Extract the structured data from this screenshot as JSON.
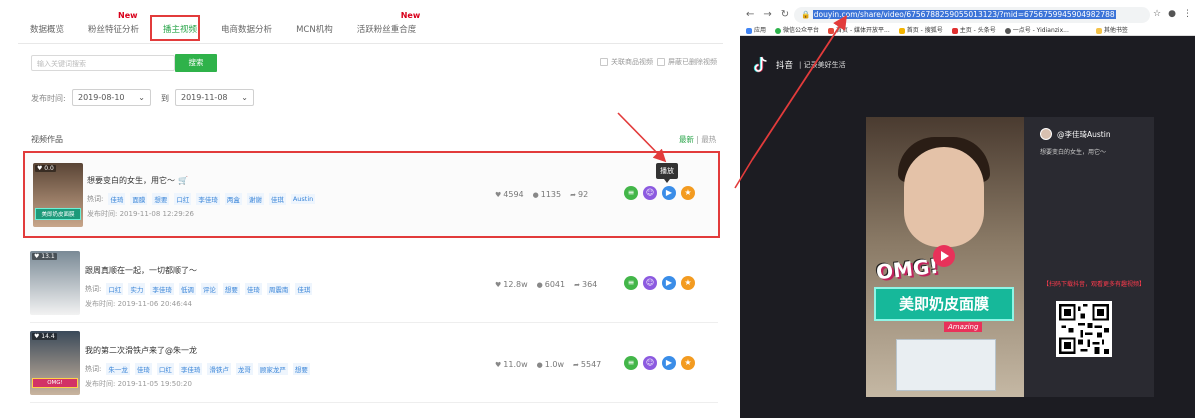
{
  "tabs": [
    {
      "label": "数据概览",
      "is_new": false,
      "active": false
    },
    {
      "label": "粉丝特征分析",
      "is_new": true,
      "active": false
    },
    {
      "label": "播主视频",
      "is_new": false,
      "active": true
    },
    {
      "label": "电商数据分析",
      "is_new": false,
      "active": false
    },
    {
      "label": "MCN机构",
      "is_new": false,
      "active": false
    },
    {
      "label": "活跃粉丝重合度",
      "is_new": true,
      "active": false
    }
  ],
  "new_badge": "New",
  "search": {
    "placeholder": "输入关键词搜索",
    "button": "搜索"
  },
  "filters": {
    "related_goods": "关联商品视频",
    "hide_deleted": "屏蔽已删除视频"
  },
  "date": {
    "label": "发布时间:",
    "start": "2019-08-10",
    "to": "到",
    "end": "2019-11-08"
  },
  "section": {
    "title": "视频作品",
    "sort_new": "最新",
    "sort_sep": "|",
    "sort_hot": "最热"
  },
  "hot_label": "热词:",
  "pub_label": "发布时间:",
  "videos": [
    {
      "likes": "0.0",
      "thumb_caption": "美即奶皮面膜",
      "title": "想要变白的女生，用它～",
      "has_cart": true,
      "tags": [
        "佳琦",
        "面膜",
        "想要",
        "口红",
        "李佳琦",
        "两盒",
        "谢谢",
        "佳琪",
        "Austin"
      ],
      "time": "2019-11-08 12:29:26",
      "stat_like": "4594",
      "stat_comment": "1135",
      "stat_share": "92"
    },
    {
      "likes": "13.1",
      "thumb_caption": "",
      "title": "跟周真顺在一起，一切都顺了～",
      "has_cart": false,
      "tags": [
        "口红",
        "实力",
        "李佳琦",
        "低调",
        "评论",
        "想要",
        "佳琦",
        "周震南",
        "佳琪"
      ],
      "time": "2019-11-06 20:46:44",
      "stat_like": "12.8w",
      "stat_comment": "6041",
      "stat_share": "364"
    },
    {
      "likes": "14.4",
      "thumb_caption": "OMG!",
      "title": "我的第二次滑铁卢来了@朱一龙",
      "has_cart": false,
      "tags": [
        "朱一龙",
        "佳琦",
        "口红",
        "李佳琦",
        "滑铁卢",
        "龙哥",
        "顾家龙严",
        "想要"
      ],
      "time": "2019-11-05 19:50:20",
      "stat_like": "11.0w",
      "stat_comment": "1.0w",
      "stat_share": "5547"
    }
  ],
  "tooltip": "播放",
  "browser": {
    "url_selected": "douyin.com/share/video/6756788259055013123/?mid=6756759945904982788",
    "bookmarks": [
      "应用",
      "微信公众平台",
      "首页 - 媒体开放平...",
      "首页 - 搜狐号",
      "主页 - 头条号",
      "一点号 - Yidianzix...",
      "其他书签"
    ],
    "app_name": "抖音",
    "app_slogan": "记录美好生活",
    "username": "@李佳琦Austin",
    "description": "想要变白的女生，用它～",
    "promo": "【扫码下载抖音，观看更多有趣视频】",
    "video_omg": "OMG!",
    "video_caption": "美即奶皮面膜",
    "video_amazing": "Amazing"
  },
  "colors": {
    "accent": "#2fb24a",
    "highlight": "#e23b3b",
    "new_badge": "#d9001b",
    "tag": "#3a85d8"
  }
}
